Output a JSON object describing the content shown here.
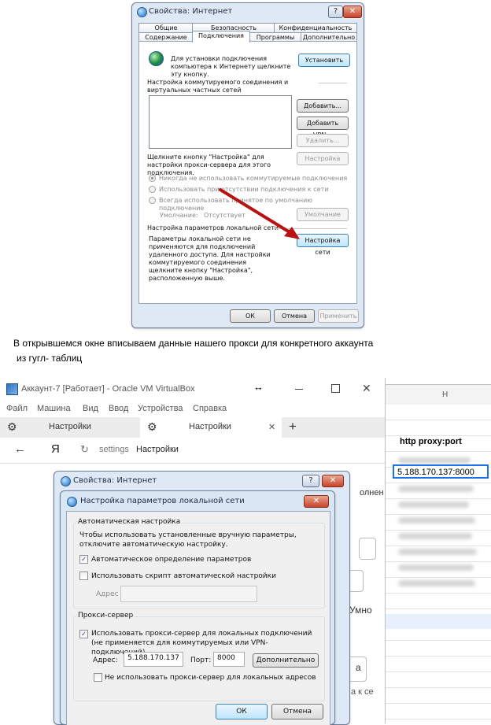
{
  "top_dialog": {
    "title": "Свойства: Интернет",
    "help": "?",
    "close": "✕",
    "tabs_row1": [
      "Общие",
      "Безопасность",
      "Конфиденциальность"
    ],
    "tabs_row2": [
      "Содержание",
      "Подключения",
      "Программы",
      "Дополнительно"
    ],
    "setup_text": "Для установки подключения компьютера к Интернету щелкните эту кнопку.",
    "setup_button": "Установить",
    "dialup_header": "Настройка коммутируемого соединения и виртуальных частных сетей",
    "add_button": "Добавить...",
    "add_vpn_button": "Добавить VPN...",
    "remove_button": "Удалить...",
    "proxy_hint": "Щелкните кнопку \"Настройка\" для настройки прокси-сервера для этого подключения.",
    "settings_button": "Настройка",
    "radio1": "Никогда не использовать коммутируемые подключения",
    "radio2": "Использовать при отсутствии подключения к сети",
    "radio3": "Всегда использовать принятое по умолчанию подключение",
    "default_label": "Умолчание:",
    "default_value": "Отсутствует",
    "default_button": "Умолчание",
    "lan_header": "Настройка параметров локальной сети",
    "lan_text": "Параметры локальной сети не применяются для подключений удаленного доступа. Для настройки коммутируемого соединения щелкните кнопку \"Настройка\", расположенную выше.",
    "lan_button": "Настройка сети",
    "ok": "ОК",
    "cancel": "Отмена",
    "apply": "Применить"
  },
  "caption": {
    "line1": "В открывшемся окне вписываем данные нашего прокси для конкретного аккаунта",
    "line2": "из гугл- таблиц"
  },
  "vbox": {
    "title": "Аккаунт-7 [Работает] - Oracle VM VirtualBox",
    "menu": [
      "Файл",
      "Машина",
      "Вид",
      "Ввод",
      "Устройства",
      "Справка"
    ],
    "tab1": "Настройки",
    "tab2": "Настройки",
    "tab_close": "✕",
    "new_tab": "+",
    "back": "←",
    "yandex": "Я",
    "reload": "↻",
    "address_prefix": "settings",
    "address_title": "Настройки"
  },
  "sheet": {
    "column": "H",
    "header": "http proxy:port",
    "selected": "5.188.170.137:8000"
  },
  "partial_text": {
    "right1": "олнен",
    "right2": "Умно",
    "right3": "а",
    "right4": "а к се"
  },
  "inet_dialog": {
    "title": "Свойства: Интернет",
    "help": "?",
    "close": "✕"
  },
  "lan_dialog": {
    "title": "Настройка параметров локальной сети",
    "close": "✕",
    "auto_group": "Автоматическая настройка",
    "auto_text": "Чтобы использовать установленные вручную параметры, отключите автоматическую настройку.",
    "auto_detect": "Автоматическое определение параметров",
    "auto_script": "Использовать скрипт автоматической настройки",
    "address_label": "Адрес",
    "proxy_group": "Прокси-сервер",
    "use_proxy": "Использовать прокси-сервер для локальных подключений (не применяется для коммутируемых или VPN-подключений).",
    "addr_label": "Адрес:",
    "addr_value": "5.188.170.137",
    "port_label": "Порт:",
    "port_value": "8000",
    "advanced_button": "Дополнительно",
    "bypass": "Не использовать прокси-сервер для локальных адресов",
    "ok": "ОК",
    "cancel": "Отмена",
    "check_mark": "✓"
  }
}
